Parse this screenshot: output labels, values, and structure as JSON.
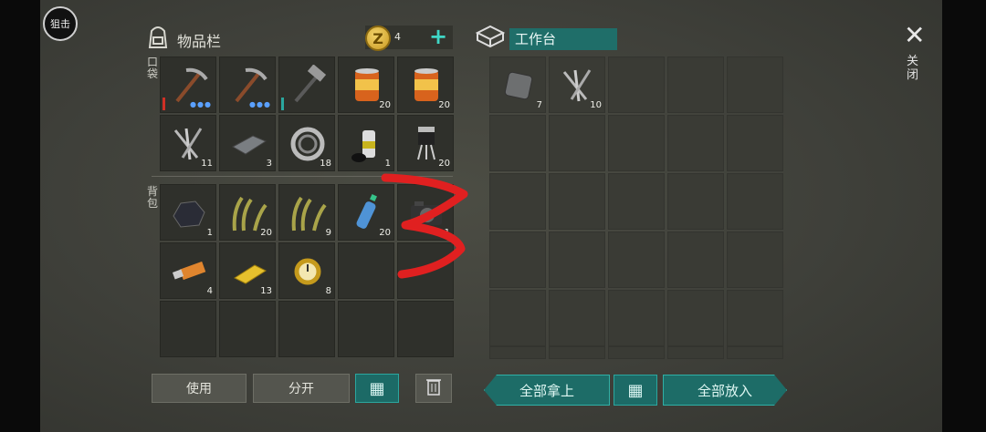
{
  "top_left_button": "狙击",
  "inventory": {
    "title": "物品栏",
    "coins": "4",
    "pocket_label": "口袋",
    "backpack_label": "背包",
    "pocket_slots": [
      {
        "icon": "pickaxe-icon",
        "count": "",
        "durability": "red",
        "dots": true
      },
      {
        "icon": "pickaxe-icon",
        "count": "",
        "durability": "",
        "dots": true
      },
      {
        "icon": "hammer-icon",
        "count": "",
        "durability": "teal",
        "dots": false
      },
      {
        "icon": "canned-food-icon",
        "count": "20"
      },
      {
        "icon": "canned-food-icon",
        "count": "20"
      },
      {
        "icon": "nails-icon",
        "count": "11"
      },
      {
        "icon": "metal-bar-icon",
        "count": "3"
      },
      {
        "icon": "bearing-icon",
        "count": "18"
      },
      {
        "icon": "spray-can-icon",
        "count": "1"
      },
      {
        "icon": "transistor-icon",
        "count": "20"
      }
    ],
    "backpack_slots": [
      {
        "icon": "coal-ore-icon",
        "count": "1"
      },
      {
        "icon": "grass-icon",
        "count": "20"
      },
      {
        "icon": "grass-icon",
        "count": "9"
      },
      {
        "icon": "water-bottle-icon",
        "count": "20"
      },
      {
        "icon": "camera-icon",
        "count": "1"
      },
      {
        "icon": "usb-drive-icon",
        "count": "4"
      },
      {
        "icon": "gold-bar-icon",
        "count": "13"
      },
      {
        "icon": "gold-watch-icon",
        "count": "8"
      },
      {
        "icon": "",
        "count": ""
      },
      {
        "icon": "",
        "count": ""
      },
      {
        "icon": "",
        "count": ""
      },
      {
        "icon": "",
        "count": ""
      },
      {
        "icon": "",
        "count": ""
      },
      {
        "icon": "",
        "count": ""
      },
      {
        "icon": "",
        "count": ""
      }
    ],
    "use_button": "使用",
    "split_button": "分开"
  },
  "workbench": {
    "title": "工作台",
    "slots": [
      {
        "icon": "metal-plate-icon",
        "count": "7"
      },
      {
        "icon": "nails-icon",
        "count": "10"
      }
    ],
    "take_all": "全部拿上",
    "put_all": "全部放入"
  },
  "close_label": "关闭",
  "colors": {
    "accent": "#1d6c67",
    "annotation": "#e02020"
  }
}
